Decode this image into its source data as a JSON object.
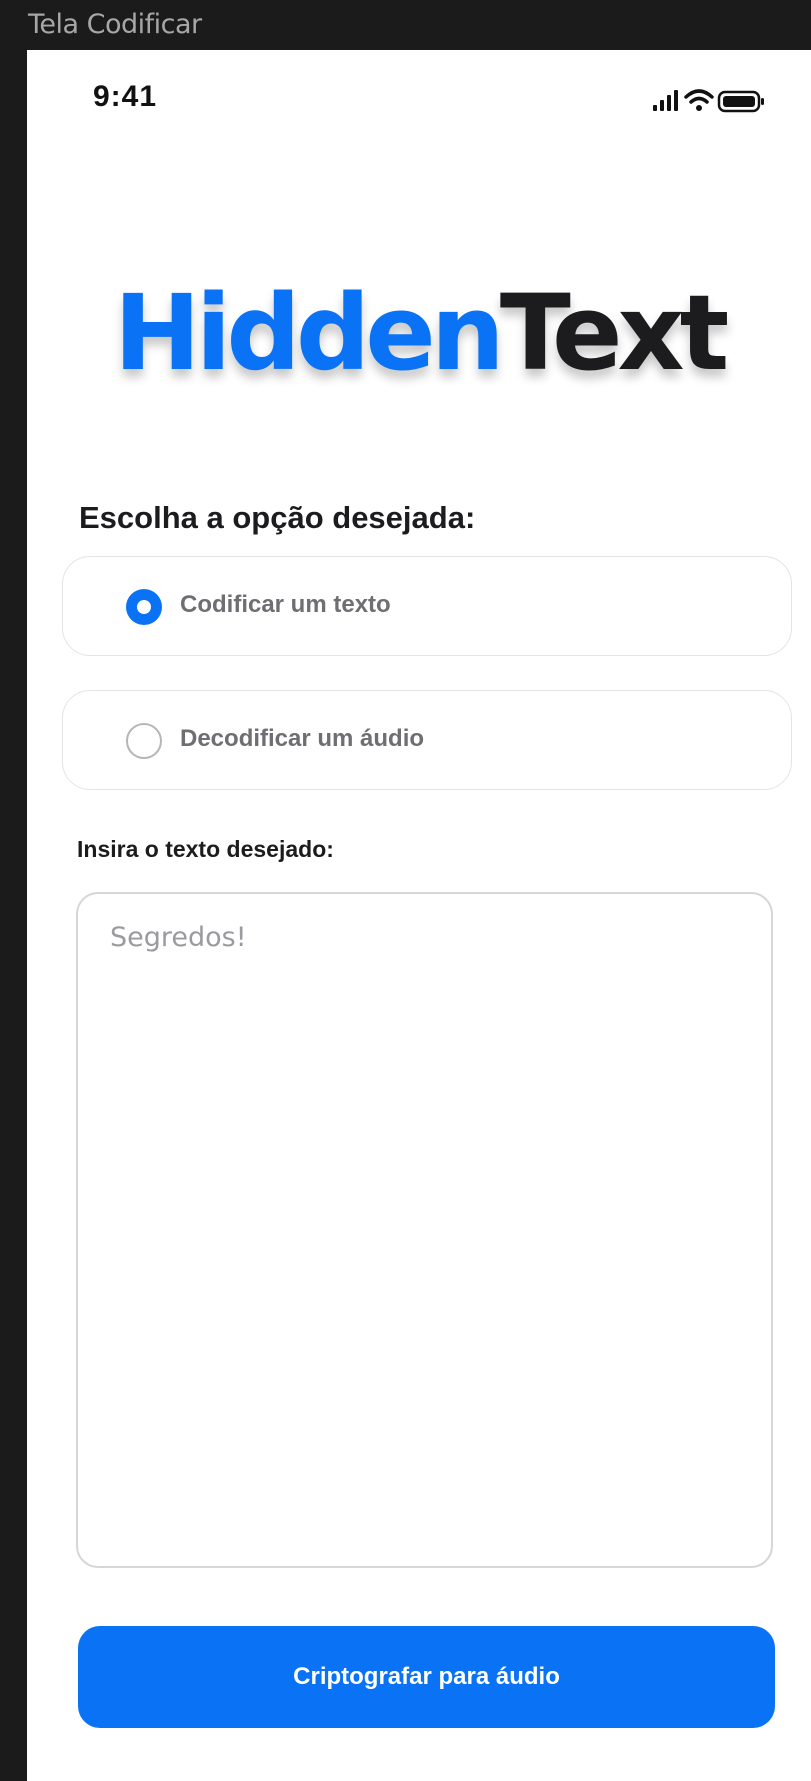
{
  "window": {
    "frame_title": "Tela Codificar"
  },
  "status_bar": {
    "time": "9:41",
    "icons": [
      "cellular-signal-icon",
      "wifi-icon",
      "battery-icon"
    ]
  },
  "logo": {
    "part1": "Hidden",
    "part2": "Text"
  },
  "form": {
    "question": "Escolha a opção desejada:",
    "options": [
      {
        "label": "Codificar um texto",
        "selected": true
      },
      {
        "label": "Decodificar um áudio",
        "selected": false
      }
    ],
    "text_label": "Insira o texto desejado:",
    "text_placeholder": "Segredos!",
    "submit_label": "Criptografar para áudio"
  },
  "colors": {
    "accent": "#0a72f5",
    "dark_text": "#1c1c1e",
    "muted_text": "#6e6e73"
  }
}
